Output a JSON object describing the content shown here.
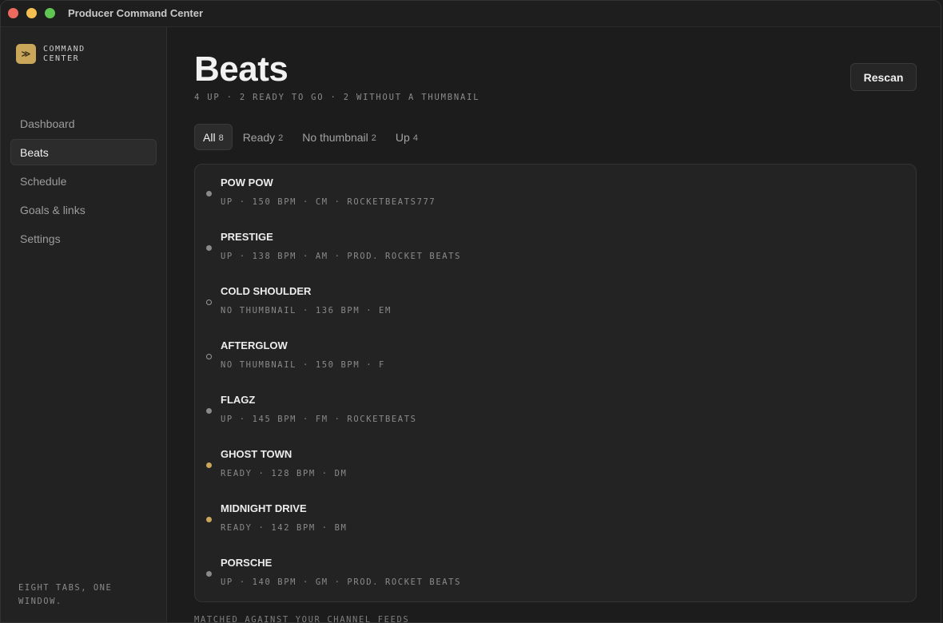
{
  "window": {
    "title": "Producer Command Center"
  },
  "sidebar": {
    "brand_icon": "≫",
    "brand_text": "COMMAND CENTER",
    "items": [
      {
        "label": "Dashboard",
        "active": false
      },
      {
        "label": "Beats",
        "active": true
      },
      {
        "label": "Schedule",
        "active": false
      },
      {
        "label": "Goals & links",
        "active": false
      },
      {
        "label": "Settings",
        "active": false
      }
    ],
    "footer": "EIGHT TABS, ONE WINDOW."
  },
  "main": {
    "title": "Beats",
    "summary": "4 UP · 2 READY TO GO · 2 WITHOUT A THUMBNAIL",
    "rescan_label": "Rescan",
    "tabs": [
      {
        "label": "All",
        "count": "8",
        "active": true
      },
      {
        "label": "Ready",
        "count": "2",
        "active": false
      },
      {
        "label": "No thumbnail",
        "count": "2",
        "active": false
      },
      {
        "label": "Up",
        "count": "4",
        "active": false
      }
    ],
    "beats": [
      {
        "title": "POW POW",
        "meta": "UP · 150 BPM · CM · ROCKETBEATS777",
        "status": "up"
      },
      {
        "title": "PRESTIGE",
        "meta": "UP · 138 BPM · AM · PROD. ROCKET BEATS",
        "status": "up"
      },
      {
        "title": "COLD SHOULDER",
        "meta": "NO THUMBNAIL · 136 BPM · EM",
        "status": "thumb"
      },
      {
        "title": "AFTERGLOW",
        "meta": "NO THUMBNAIL · 150 BPM · F",
        "status": "thumb"
      },
      {
        "title": "FLAGZ",
        "meta": "UP · 145 BPM · FM · ROCKETBEATS",
        "status": "up"
      },
      {
        "title": "GHOST TOWN",
        "meta": "READY · 128 BPM · DM",
        "status": "ready"
      },
      {
        "title": "MIDNIGHT DRIVE",
        "meta": "READY · 142 BPM · BM",
        "status": "ready"
      },
      {
        "title": "PORSCHE",
        "meta": "UP · 140 BPM · GM · PROD. ROCKET BEATS",
        "status": "up"
      }
    ],
    "footer_note": "MATCHED AGAINST YOUR CHANNEL FEEDS"
  },
  "colors": {
    "background": "#1c1c1c",
    "accent": "#c9a65a",
    "up_dot": "#8a8a8a"
  }
}
